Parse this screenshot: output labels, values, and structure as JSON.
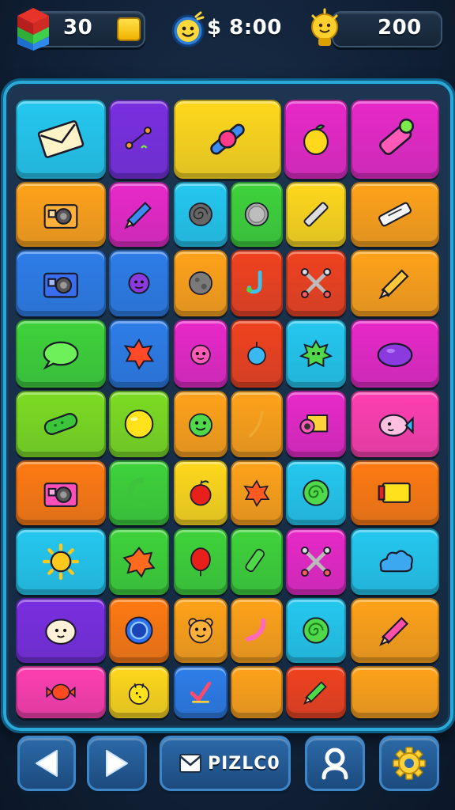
{
  "hud": {
    "blocks_count": "30",
    "money": "$ 8:00",
    "score": "200"
  },
  "bottom_bar": {
    "puzzle_label": "PIZLC0"
  },
  "icons": {
    "left": "cube-stack-icon",
    "middle": "smiley-coin-icon",
    "right": "bulb-icon"
  },
  "board": {
    "rows": 9,
    "tiles": [
      [
        "envelope",
        "stick-figure",
        "pinwheel",
        "lemon",
        "bottle"
      ],
      [
        "camera",
        "pencil",
        "spiral-disc",
        "gray-coin",
        "chalk",
        "tube"
      ],
      [
        "camera-blue",
        "purple-blob",
        "moon-rock",
        "hook",
        "crossed-bones",
        "pencil-yellow"
      ],
      [
        "green-bubble",
        "leaf",
        "pink-bug",
        "blue-drop",
        "green-splat",
        "purple-blob-wide"
      ],
      [
        "pickle",
        "yellow-ball",
        "green-face",
        "stick",
        "projector",
        "fish"
      ],
      [
        "camera-pink",
        "green-curl",
        "apple",
        "orange-leaf",
        "green-spiral",
        "battery"
      ],
      [
        "sun",
        "orange-splat",
        "red-balloon",
        "green-tube",
        "crossed-sticks",
        "blue-cloud"
      ],
      [
        "white-ghost",
        "blue-ring",
        "bear-face",
        "curved-pipe",
        "green-swirl",
        "pink-marker"
      ],
      [
        "red-candy",
        "yellow-chick",
        "check-mark",
        "",
        "green-pencil",
        ""
      ]
    ]
  }
}
